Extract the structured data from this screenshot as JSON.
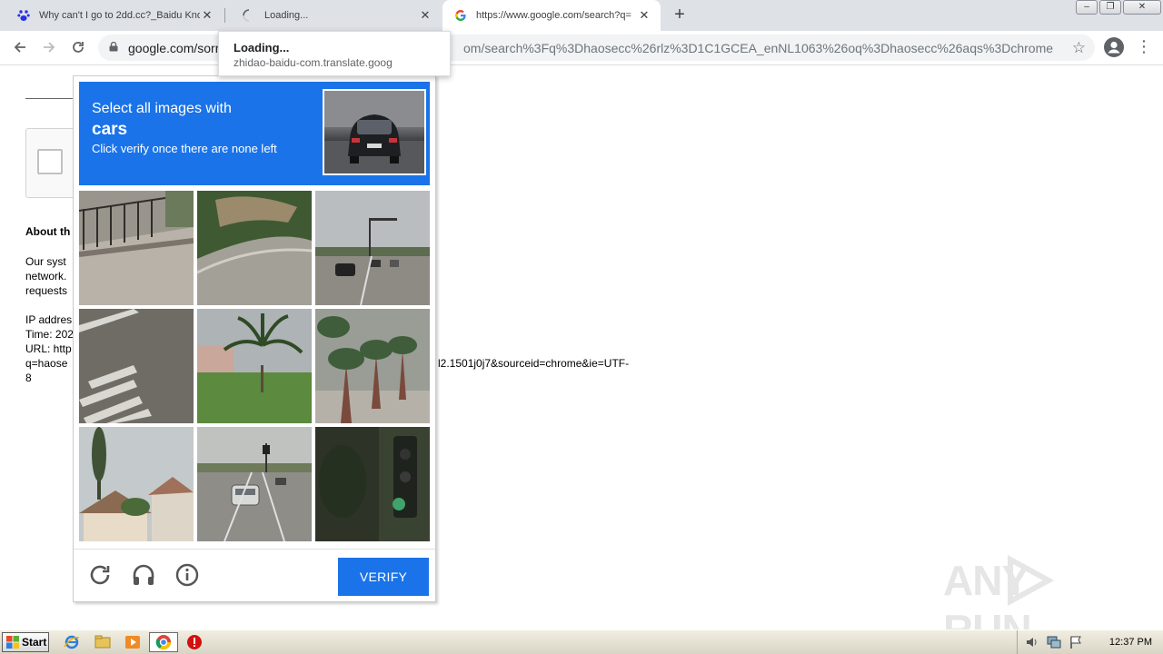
{
  "browser": {
    "tabs": [
      {
        "title": "Why can't I go to 2dd.cc?_Baidu Kno",
        "icon": "baidu-paw-icon",
        "active": false
      },
      {
        "title": "Loading...",
        "icon": "loading-spinner-icon",
        "active": false
      },
      {
        "title": "https://www.google.com/search?q=",
        "icon": "google-g-icon",
        "active": true
      }
    ],
    "new_tab_label": "+",
    "url_host": "google.com/sorr",
    "url_rest": "om/search%3Fq%3Dhaosecc%26rlz%3D1C1GCEA_enNL1063%26oq%3Dhaosecc%26aqs%3Dchrome.....",
    "loading_tip": {
      "title": "Loading...",
      "host": "zhidao-baidu-com.translate.goog"
    }
  },
  "page": {
    "about_heading": "About th",
    "para1": [
      "Our syst",
      "network.",
      "requests"
    ],
    "para2": [
      "IP addres",
      "Time: 202",
      "URL: http",
      "q=haose",
      "8"
    ],
    "tail_url": "l2.1501j0j7&sourceid=chrome&ie=UTF-"
  },
  "captcha": {
    "instruction_line1": "Select all images with",
    "target": "cars",
    "instruction_line3": "Click verify once there are none left",
    "verify_label": "VERIFY",
    "tiles": [
      "railing-sidewalk",
      "hillside-road",
      "street-with-cars",
      "crosswalk-asphalt",
      "palm-tree-grass",
      "palm-trunks-median",
      "houses-palms",
      "road-with-car",
      "traffic-light-dark"
    ]
  },
  "watermark": {
    "left": "ANY",
    "right": "RUN"
  },
  "taskbar": {
    "start_label": "Start",
    "clock": "12:37 PM"
  },
  "colors": {
    "accent": "#1a73e8",
    "tab_bar": "#dee1e6"
  }
}
